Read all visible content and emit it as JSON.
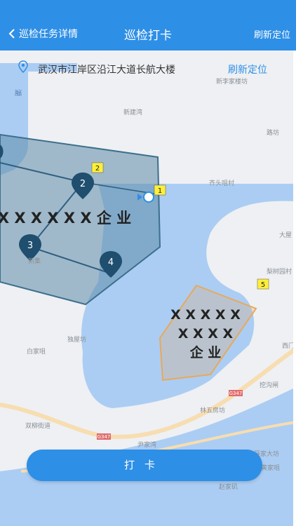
{
  "nav": {
    "back_label": "巡检任务详情",
    "title": "巡检打卡",
    "action_label": "刷新定位"
  },
  "location": {
    "address": "武汉市江岸区沿江大道长航大楼",
    "refresh_label": "刷新定位"
  },
  "map": {
    "enterprise_main_label": "X X X X X X 企 业",
    "enterprise_2_line1": "X X X X X",
    "enterprise_2_line2": "X X X X",
    "enterprise_2_line3": "企 业",
    "waypoints": [
      "1",
      "2",
      "3",
      "4",
      "5"
    ],
    "place_labels": [
      "新李家楼坊",
      "新建湾",
      "路坊",
      "齐头咀村",
      "大屋",
      "梨树园村",
      "5",
      "独屋坊",
      "白家咀",
      "西门",
      "挖沟闸",
      "林五房坊",
      "双柳街道",
      "尹家湾",
      "聂家大坊",
      "黄家咀",
      "赵家矶",
      "湖",
      "新集",
      "G347",
      "G347"
    ],
    "colors": {
      "water": "#abcdf3",
      "land": "#eef0f3",
      "road": "#f7ddb0",
      "zone_main": "#5f8ca8",
      "zone_secondary": "#e8a85c",
      "marker": "#1f4e6e",
      "accent": "#2e8fe6"
    }
  },
  "checkin": {
    "label": "打卡"
  }
}
